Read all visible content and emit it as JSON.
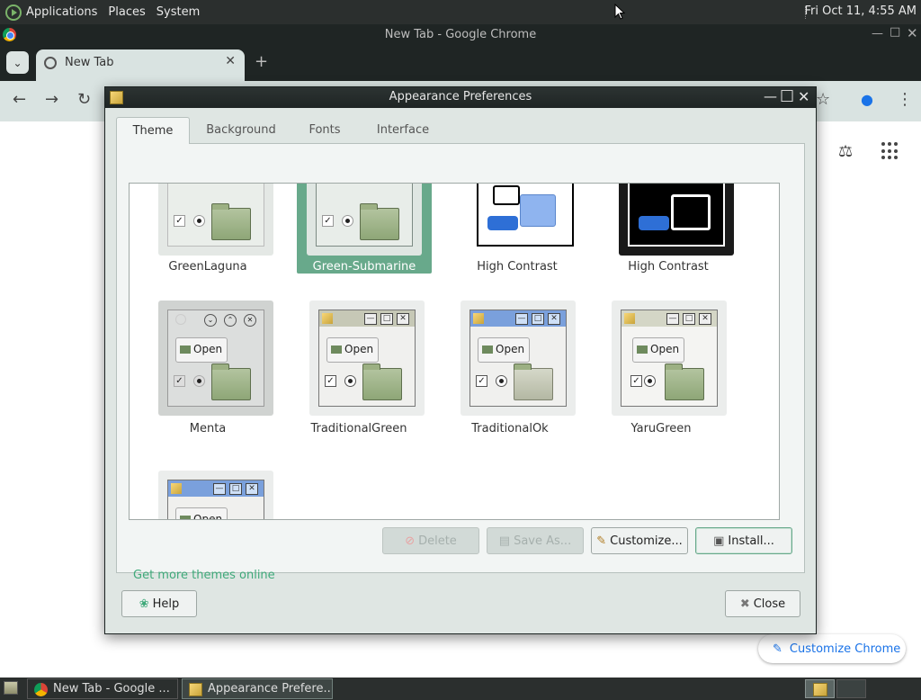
{
  "top_panel": {
    "menus": [
      "Applications",
      "Places",
      "System"
    ],
    "clock": "Fri Oct 11,  4:55 AM"
  },
  "chrome": {
    "window_title": "New Tab - Google Chrome",
    "tab_label": "New Tab",
    "customize_label": "Customize Chrome"
  },
  "dialog": {
    "title": "Appearance Preferences",
    "tabs": [
      "Theme",
      "Background",
      "Fonts",
      "Interface"
    ],
    "active_tab": "Theme",
    "themes": [
      {
        "name": "GreenLaguna"
      },
      {
        "name": "Green-Submarine",
        "selected": true
      },
      {
        "name": "High Contrast"
      },
      {
        "name": "High Contrast"
      },
      {
        "name": "Menta"
      },
      {
        "name": "TraditionalGreen"
      },
      {
        "name": "TraditionalOk"
      },
      {
        "name": "YaruGreen"
      },
      {
        "name": ""
      }
    ],
    "thumbnail_text": "Open",
    "buttons": {
      "delete": "Delete",
      "save_as": "Save As...",
      "customize": "Customize...",
      "install": "Install...",
      "help": "Help",
      "close": "Close"
    },
    "more_themes_link": "Get more themes online"
  },
  "taskbar": {
    "tasks": [
      "New Tab - Google ...",
      "Appearance Prefere..."
    ]
  },
  "colors": {
    "selection": "#68a98b",
    "link": "#3fa97a",
    "panel": "#2b2f2e",
    "chrome_toolbar": "#d9e3e1"
  }
}
